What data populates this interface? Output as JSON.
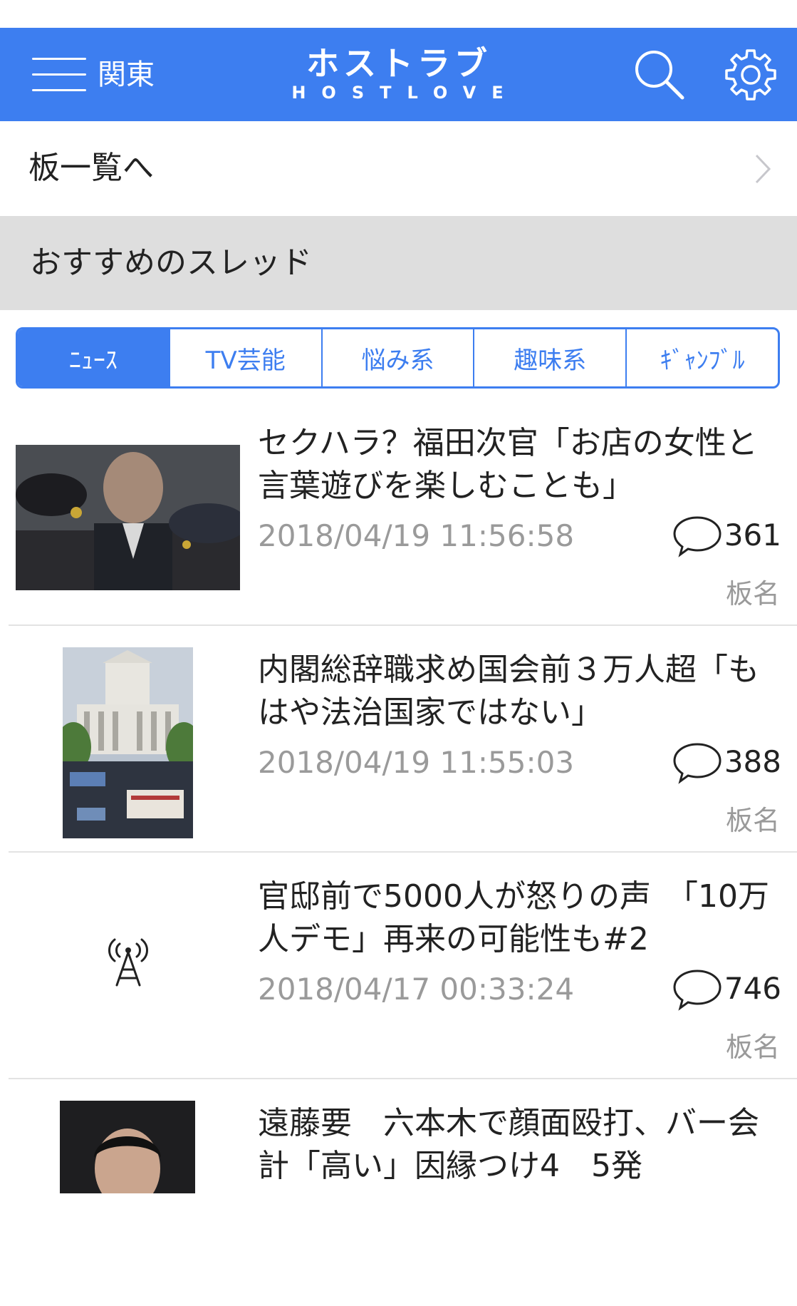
{
  "header": {
    "region": "関東",
    "logo_main": "ホストラブ",
    "logo_sub": "HOSTLOVE"
  },
  "board_list_link": "板一覧へ",
  "section_title": "おすすめのスレッド",
  "tabs": [
    {
      "label": "ﾆｭｰｽ",
      "active": true
    },
    {
      "label": "TV芸能",
      "active": false
    },
    {
      "label": "悩み系",
      "active": false
    },
    {
      "label": "趣味系",
      "active": false
    },
    {
      "label": "ｷﾞｬﾝﾌﾞﾙ",
      "active": false
    }
  ],
  "threads": [
    {
      "title": "セクハラ？福田次官「お店の女性と言葉遊びを楽しむことも」",
      "date": "2018/04/19 11:56:58",
      "comments": "361",
      "board": "板名"
    },
    {
      "title": "内閣総辞職求め国会前３万人超「もはや法治国家ではない」",
      "date": "2018/04/19 11:55:03",
      "comments": "388",
      "board": "板名"
    },
    {
      "title": "官邸前で5000人が怒りの声　「10万人デモ」再来の可能性も#2",
      "date": "2018/04/17 00:33:24",
      "comments": "746",
      "board": "板名"
    },
    {
      "title": "遠藤要　六本木で顔面殴打、バー会計「高い」因縁つけ4　5発",
      "date": "",
      "comments": "",
      "board": ""
    }
  ],
  "colors": {
    "accent": "#3d7ef0",
    "section_bg": "#dedede",
    "meta_gray": "#9a9a9a"
  }
}
